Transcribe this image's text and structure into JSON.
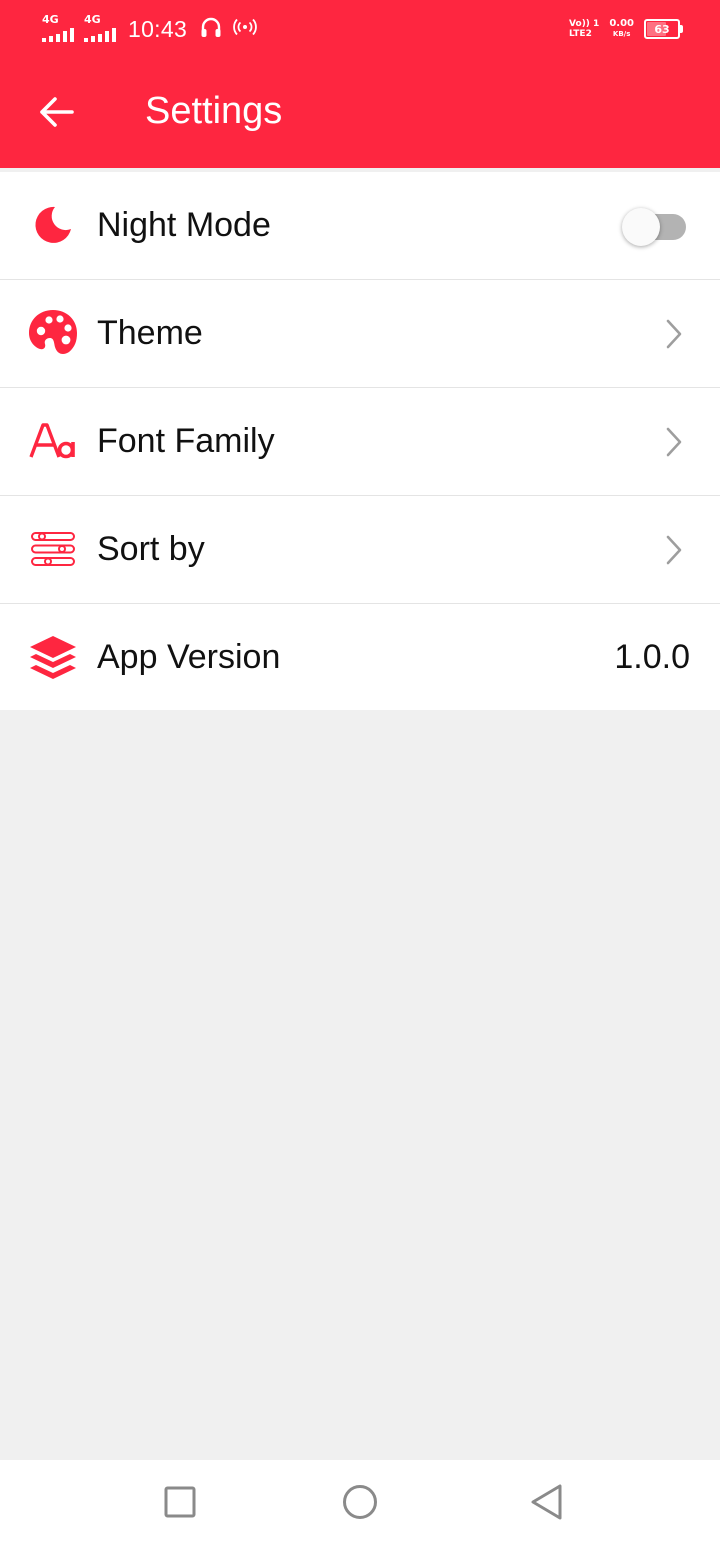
{
  "status_bar": {
    "sim1_label": "4G",
    "sim2_label": "4G",
    "time": "10:43",
    "volte_line1": "Vo)) 1",
    "volte_line2": "LTE2",
    "speed_value": "0.00",
    "speed_unit": "KB/s",
    "battery_level": "63",
    "battery_fraction": 0.63,
    "icons": [
      "signal-icon",
      "headphones-icon",
      "hotspot-icon",
      "battery-icon"
    ]
  },
  "toolbar": {
    "title": "Settings",
    "back_icon": "arrow-left-icon"
  },
  "colors": {
    "accent": "#fe2640",
    "background": "#f0f0f0",
    "surface": "#ffffff",
    "text": "#111111",
    "chevron": "#9e9e9e",
    "toggle_track_off": "#b3b3b3"
  },
  "settings": {
    "night_mode": {
      "label": "Night Mode",
      "icon": "moon-icon",
      "enabled": false
    },
    "theme": {
      "label": "Theme",
      "icon": "palette-icon"
    },
    "font_family": {
      "label": "Font Family",
      "icon": "font-icon"
    },
    "sort_by": {
      "label": "Sort by",
      "icon": "sort-sliders-icon"
    },
    "app_version": {
      "label": "App Version",
      "icon": "layers-icon",
      "value": "1.0.0"
    }
  },
  "nav_bar": {
    "buttons": [
      "recent-apps-icon",
      "home-icon",
      "back-triangle-icon"
    ]
  }
}
